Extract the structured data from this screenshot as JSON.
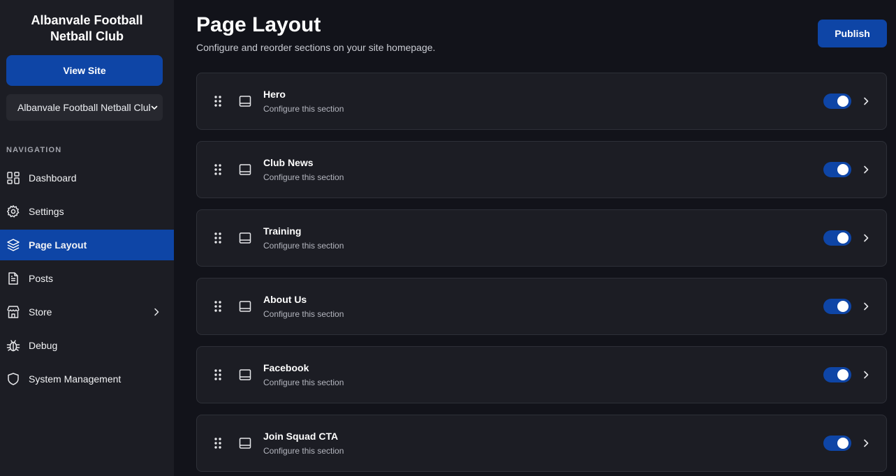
{
  "sidebar": {
    "club_name": "Albanvale Football Netball Club",
    "view_site_label": "View Site",
    "club_select_value": "Albanvale Football Netball Club",
    "nav_heading": "NAVIGATION",
    "items": [
      {
        "label": "Dashboard",
        "icon": "dashboard-icon",
        "active": false
      },
      {
        "label": "Settings",
        "icon": "gear-icon",
        "active": false
      },
      {
        "label": "Page Layout",
        "icon": "layers-icon",
        "active": true
      },
      {
        "label": "Posts",
        "icon": "document-icon",
        "active": false
      },
      {
        "label": "Store",
        "icon": "store-icon",
        "active": false,
        "has_submenu": true
      },
      {
        "label": "Debug",
        "icon": "bug-icon",
        "active": false
      },
      {
        "label": "System Management",
        "icon": "shield-icon",
        "active": false
      }
    ]
  },
  "main": {
    "title": "Page Layout",
    "subtitle": "Configure and reorder sections on your site homepage.",
    "publish_label": "Publish",
    "sections": [
      {
        "name": "Hero",
        "description": "Configure this section",
        "enabled": true
      },
      {
        "name": "Club News",
        "description": "Configure this section",
        "enabled": true
      },
      {
        "name": "Training",
        "description": "Configure this section",
        "enabled": true
      },
      {
        "name": "About Us",
        "description": "Configure this section",
        "enabled": true
      },
      {
        "name": "Facebook",
        "description": "Configure this section",
        "enabled": true
      },
      {
        "name": "Join Squad CTA",
        "description": "Configure this section",
        "enabled": true
      }
    ]
  },
  "colors": {
    "accent": "#0e45a6",
    "sidebar_bg": "#1c1d24",
    "page_bg": "#12131a",
    "card_border": "#2e3038"
  }
}
